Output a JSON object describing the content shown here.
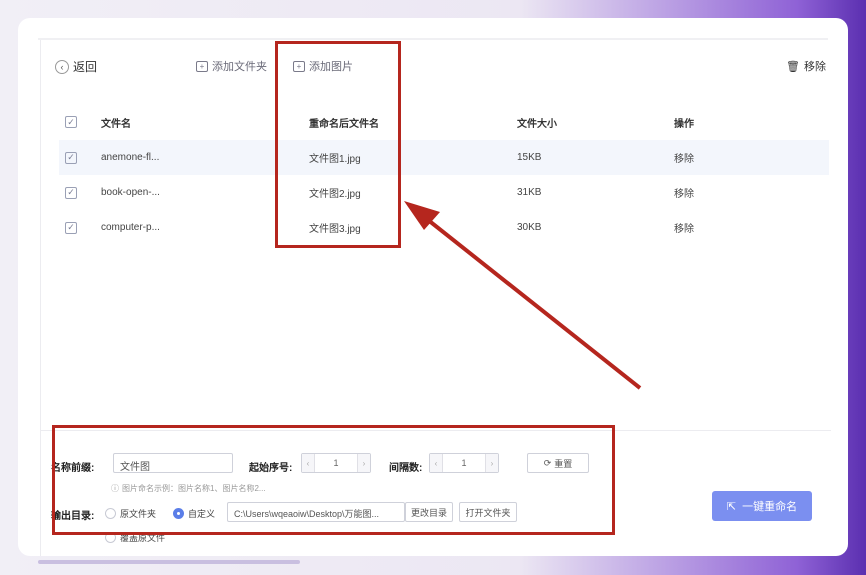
{
  "toolbar": {
    "back_label": "返回",
    "add_folder_label": "添加文件夹",
    "add_image_label": "添加图片",
    "remove_label": "移除"
  },
  "table": {
    "headers": [
      "文件名",
      "重命名后文件名",
      "文件大小",
      "操作"
    ],
    "rows": [
      {
        "name": "anemone-fl...",
        "new_name": "文件图1.jpg",
        "size": "15KB",
        "action": "移除"
      },
      {
        "name": "book-open-...",
        "new_name": "文件图2.jpg",
        "size": "31KB",
        "action": "移除"
      },
      {
        "name": "computer-p...",
        "new_name": "文件图3.jpg",
        "size": "30KB",
        "action": "移除"
      }
    ]
  },
  "settings": {
    "prefix_label": "名称前缀:",
    "prefix_value": "文件图",
    "start_label": "起始序号:",
    "start_value": "1",
    "interval_label": "间隔数:",
    "interval_value": "1",
    "reset_label": "重置",
    "hint": "图片命名示例：图片名称1、图片名称2...",
    "output_label": "输出目录:",
    "opt_original": "原文件夹",
    "opt_custom": "自定义",
    "path_value": "C:\\Users\\wqeaoiw\\Desktop\\万能图...",
    "change_dir": "更改目录",
    "open_folder": "打开文件夹",
    "opt_overwrite": "覆盖原文件",
    "rename_button": "一键重命名"
  },
  "colors": {
    "accent": "#7b8ff0",
    "annotation_red": "#b5261e"
  }
}
